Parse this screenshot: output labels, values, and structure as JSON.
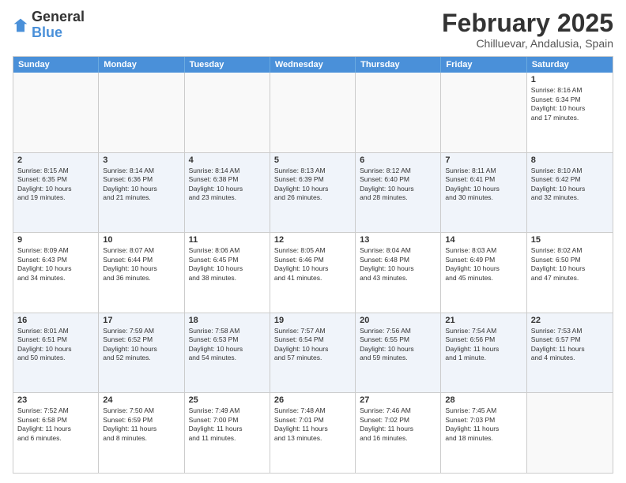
{
  "logo": {
    "general": "General",
    "blue": "Blue"
  },
  "title": "February 2025",
  "location": "Chilluevar, Andalusia, Spain",
  "header_days": [
    "Sunday",
    "Monday",
    "Tuesday",
    "Wednesday",
    "Thursday",
    "Friday",
    "Saturday"
  ],
  "weeks": [
    {
      "alt": false,
      "cells": [
        {
          "day": "",
          "text": ""
        },
        {
          "day": "",
          "text": ""
        },
        {
          "day": "",
          "text": ""
        },
        {
          "day": "",
          "text": ""
        },
        {
          "day": "",
          "text": ""
        },
        {
          "day": "",
          "text": ""
        },
        {
          "day": "1",
          "text": "Sunrise: 8:16 AM\nSunset: 6:34 PM\nDaylight: 10 hours\nand 17 minutes."
        }
      ]
    },
    {
      "alt": true,
      "cells": [
        {
          "day": "2",
          "text": "Sunrise: 8:15 AM\nSunset: 6:35 PM\nDaylight: 10 hours\nand 19 minutes."
        },
        {
          "day": "3",
          "text": "Sunrise: 8:14 AM\nSunset: 6:36 PM\nDaylight: 10 hours\nand 21 minutes."
        },
        {
          "day": "4",
          "text": "Sunrise: 8:14 AM\nSunset: 6:38 PM\nDaylight: 10 hours\nand 23 minutes."
        },
        {
          "day": "5",
          "text": "Sunrise: 8:13 AM\nSunset: 6:39 PM\nDaylight: 10 hours\nand 26 minutes."
        },
        {
          "day": "6",
          "text": "Sunrise: 8:12 AM\nSunset: 6:40 PM\nDaylight: 10 hours\nand 28 minutes."
        },
        {
          "day": "7",
          "text": "Sunrise: 8:11 AM\nSunset: 6:41 PM\nDaylight: 10 hours\nand 30 minutes."
        },
        {
          "day": "8",
          "text": "Sunrise: 8:10 AM\nSunset: 6:42 PM\nDaylight: 10 hours\nand 32 minutes."
        }
      ]
    },
    {
      "alt": false,
      "cells": [
        {
          "day": "9",
          "text": "Sunrise: 8:09 AM\nSunset: 6:43 PM\nDaylight: 10 hours\nand 34 minutes."
        },
        {
          "day": "10",
          "text": "Sunrise: 8:07 AM\nSunset: 6:44 PM\nDaylight: 10 hours\nand 36 minutes."
        },
        {
          "day": "11",
          "text": "Sunrise: 8:06 AM\nSunset: 6:45 PM\nDaylight: 10 hours\nand 38 minutes."
        },
        {
          "day": "12",
          "text": "Sunrise: 8:05 AM\nSunset: 6:46 PM\nDaylight: 10 hours\nand 41 minutes."
        },
        {
          "day": "13",
          "text": "Sunrise: 8:04 AM\nSunset: 6:48 PM\nDaylight: 10 hours\nand 43 minutes."
        },
        {
          "day": "14",
          "text": "Sunrise: 8:03 AM\nSunset: 6:49 PM\nDaylight: 10 hours\nand 45 minutes."
        },
        {
          "day": "15",
          "text": "Sunrise: 8:02 AM\nSunset: 6:50 PM\nDaylight: 10 hours\nand 47 minutes."
        }
      ]
    },
    {
      "alt": true,
      "cells": [
        {
          "day": "16",
          "text": "Sunrise: 8:01 AM\nSunset: 6:51 PM\nDaylight: 10 hours\nand 50 minutes."
        },
        {
          "day": "17",
          "text": "Sunrise: 7:59 AM\nSunset: 6:52 PM\nDaylight: 10 hours\nand 52 minutes."
        },
        {
          "day": "18",
          "text": "Sunrise: 7:58 AM\nSunset: 6:53 PM\nDaylight: 10 hours\nand 54 minutes."
        },
        {
          "day": "19",
          "text": "Sunrise: 7:57 AM\nSunset: 6:54 PM\nDaylight: 10 hours\nand 57 minutes."
        },
        {
          "day": "20",
          "text": "Sunrise: 7:56 AM\nSunset: 6:55 PM\nDaylight: 10 hours\nand 59 minutes."
        },
        {
          "day": "21",
          "text": "Sunrise: 7:54 AM\nSunset: 6:56 PM\nDaylight: 11 hours\nand 1 minute."
        },
        {
          "day": "22",
          "text": "Sunrise: 7:53 AM\nSunset: 6:57 PM\nDaylight: 11 hours\nand 4 minutes."
        }
      ]
    },
    {
      "alt": false,
      "cells": [
        {
          "day": "23",
          "text": "Sunrise: 7:52 AM\nSunset: 6:58 PM\nDaylight: 11 hours\nand 6 minutes."
        },
        {
          "day": "24",
          "text": "Sunrise: 7:50 AM\nSunset: 6:59 PM\nDaylight: 11 hours\nand 8 minutes."
        },
        {
          "day": "25",
          "text": "Sunrise: 7:49 AM\nSunset: 7:00 PM\nDaylight: 11 hours\nand 11 minutes."
        },
        {
          "day": "26",
          "text": "Sunrise: 7:48 AM\nSunset: 7:01 PM\nDaylight: 11 hours\nand 13 minutes."
        },
        {
          "day": "27",
          "text": "Sunrise: 7:46 AM\nSunset: 7:02 PM\nDaylight: 11 hours\nand 16 minutes."
        },
        {
          "day": "28",
          "text": "Sunrise: 7:45 AM\nSunset: 7:03 PM\nDaylight: 11 hours\nand 18 minutes."
        },
        {
          "day": "",
          "text": ""
        }
      ]
    }
  ]
}
